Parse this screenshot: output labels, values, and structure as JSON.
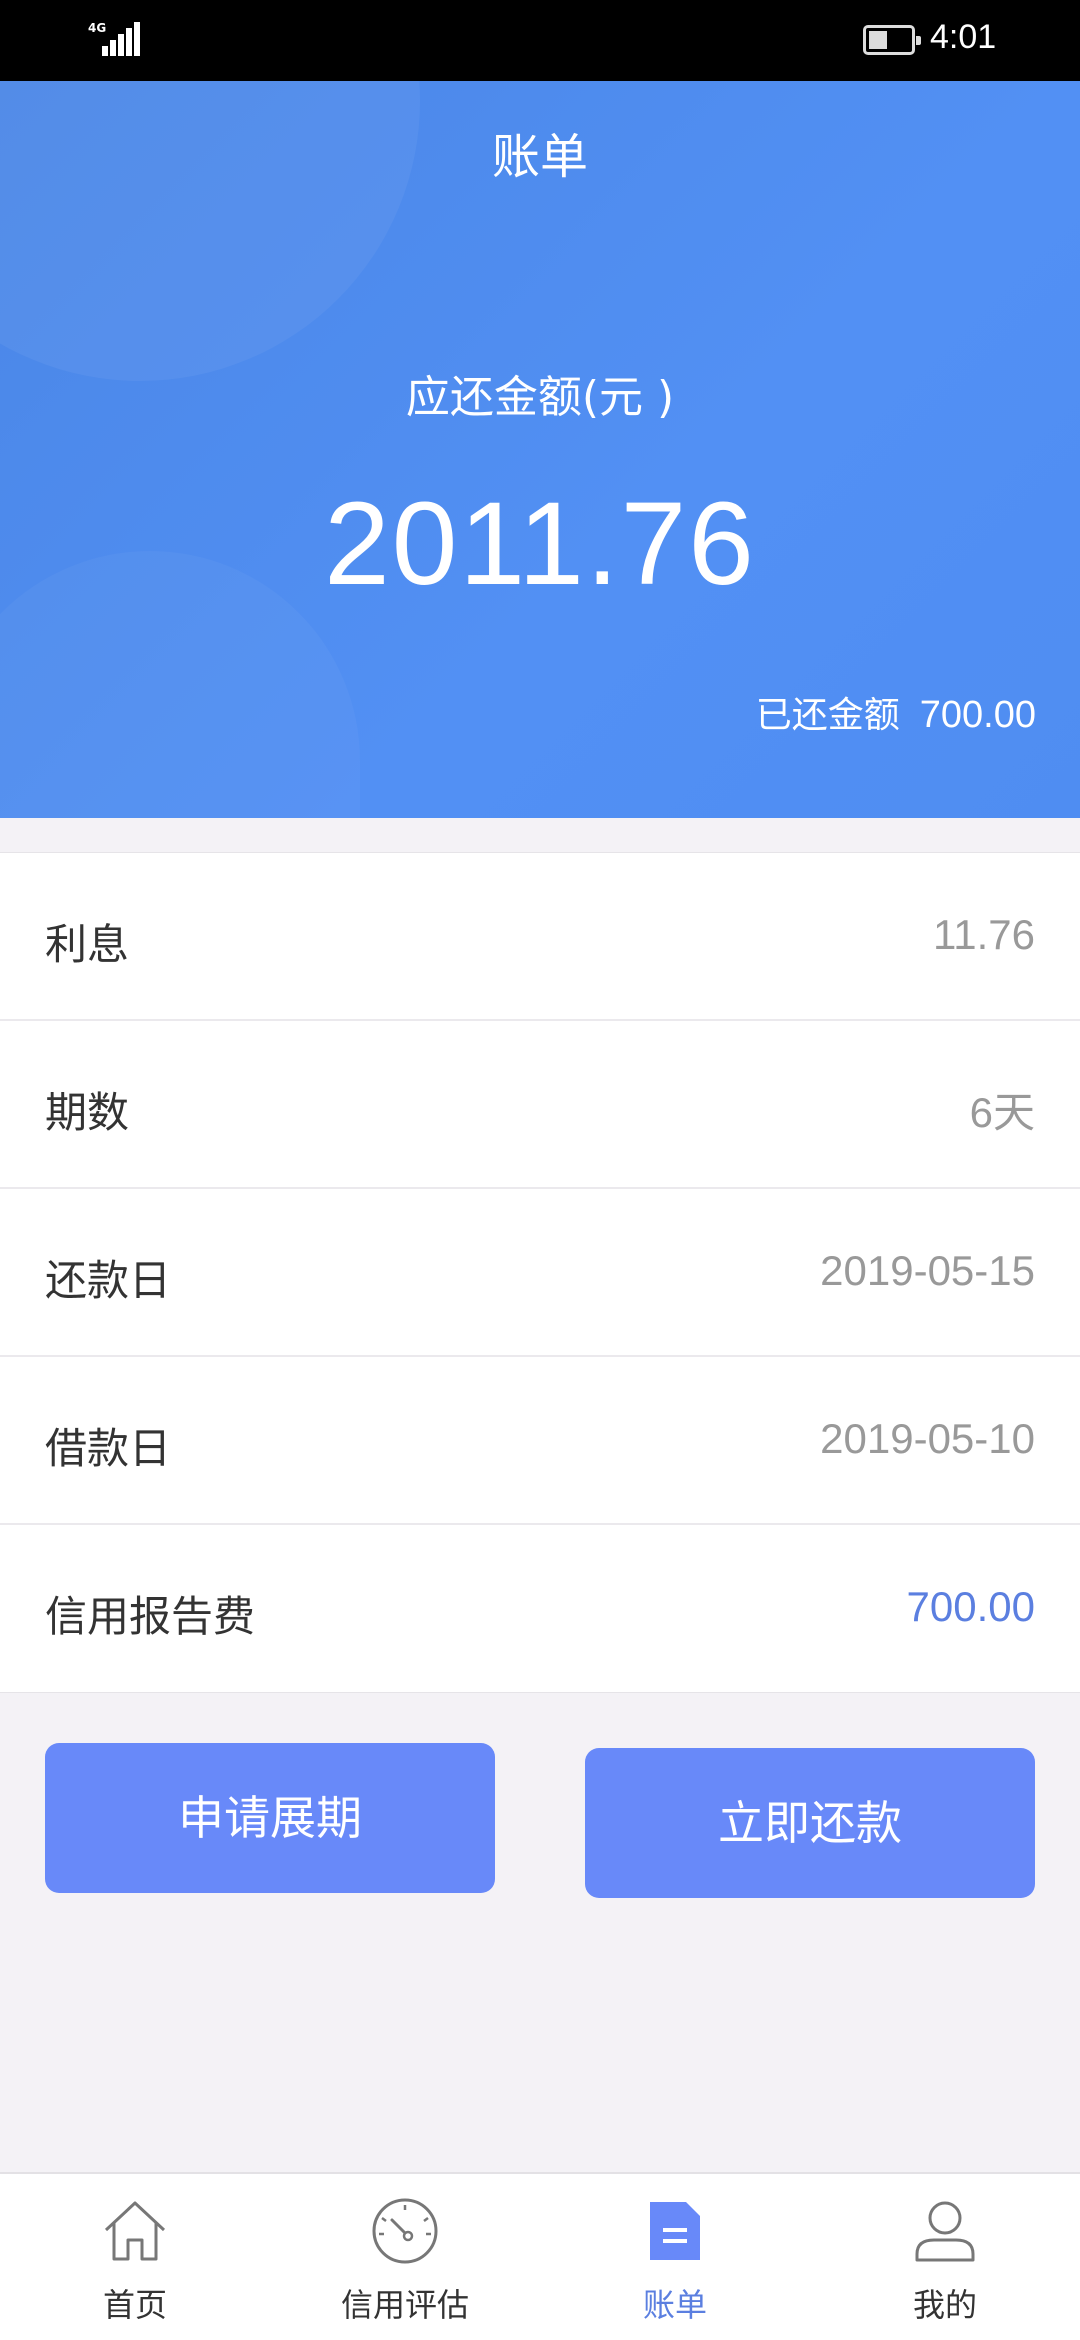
{
  "status_bar": {
    "network": "4G",
    "time": "4:01"
  },
  "header": {
    "title": "账单",
    "amount_label": "应还金额(元 )",
    "amount": "2011.76",
    "paid_label": "已还金额",
    "paid_value": "700.00"
  },
  "details": [
    {
      "label": "利息",
      "value": "11.76"
    },
    {
      "label": "期数",
      "value": "6天"
    },
    {
      "label": "还款日",
      "value": "2019-05-15"
    },
    {
      "label": "借款日",
      "value": "2019-05-10"
    },
    {
      "label": "信用报告费",
      "value": "700.00"
    }
  ],
  "actions": {
    "extend_label": "申请展期",
    "repay_label": "立即还款"
  },
  "tabbar": {
    "items": [
      {
        "label": "首页",
        "icon": "home-icon"
      },
      {
        "label": "信用评估",
        "icon": "gauge-icon"
      },
      {
        "label": "账单",
        "icon": "bill-icon"
      },
      {
        "label": "我的",
        "icon": "user-icon"
      }
    ],
    "active_index": 2
  },
  "colors": {
    "header_blue": "#4f8df2",
    "button_blue": "#6889f9",
    "accent": "#5b7fe0"
  }
}
